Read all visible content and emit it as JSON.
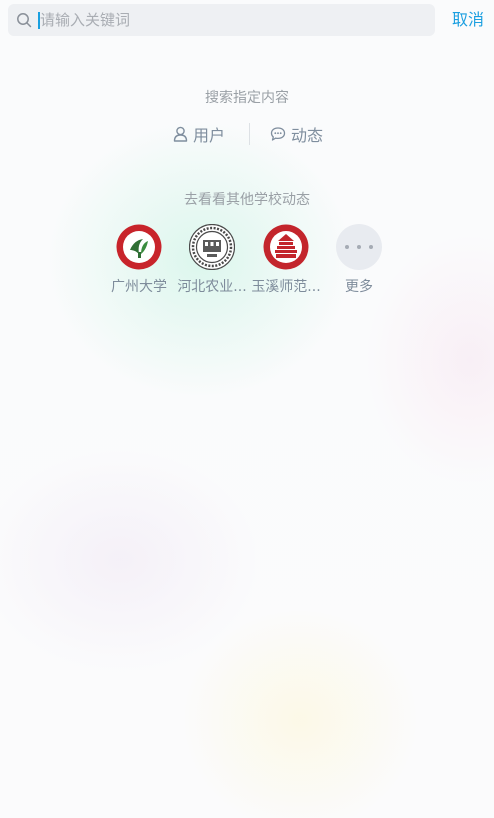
{
  "search": {
    "placeholder": "请输入关键词",
    "cancel_label": "取消"
  },
  "filter_section": {
    "title": "搜索指定内容",
    "options": [
      {
        "label": "用户",
        "icon": "user-icon"
      },
      {
        "label": "动态",
        "icon": "comment-icon"
      }
    ]
  },
  "schools_section": {
    "title": "去看看其他学校动态",
    "schools": [
      {
        "name": "广州大学"
      },
      {
        "name": "河北农业..."
      },
      {
        "name": "玉溪师范..."
      }
    ],
    "more_label": "更多"
  },
  "colors": {
    "accent": "#1b9fe0",
    "muted_text": "#9aa0a6",
    "label_text": "#7f8e9e"
  }
}
